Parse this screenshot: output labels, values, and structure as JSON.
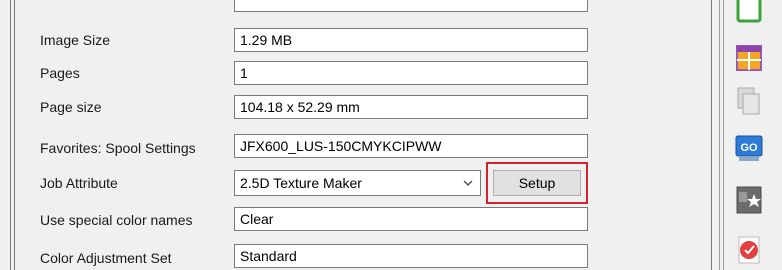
{
  "properties": {
    "image_size": {
      "label": "Image Size",
      "value": "1.29 MB"
    },
    "pages": {
      "label": "Pages",
      "value": "1"
    },
    "page_size": {
      "label": "Page size",
      "value": "104.18 x 52.29 mm"
    },
    "spool_settings": {
      "label": "Favorites: Spool Settings",
      "value": "JFX600_LUS-150CMYKCIPWW"
    },
    "job_attribute": {
      "label": "Job Attribute",
      "value": "2.5D Texture Maker",
      "setup_label": "Setup"
    },
    "special_color_names": {
      "label": "Use special color names",
      "value": "Clear"
    },
    "color_adjustment": {
      "label": "Color Adjustment Set",
      "value": "Standard"
    }
  },
  "toolbar": {
    "icons": [
      "green-frame-icon",
      "table-icon",
      "copy-pages-icon",
      "go-icon",
      "star-image-icon",
      "stamp-icon"
    ],
    "go_text": "GO"
  },
  "colors": {
    "highlight": "#d3212d",
    "field_border": "#7a7a7a",
    "background": "#f0f0f0"
  }
}
